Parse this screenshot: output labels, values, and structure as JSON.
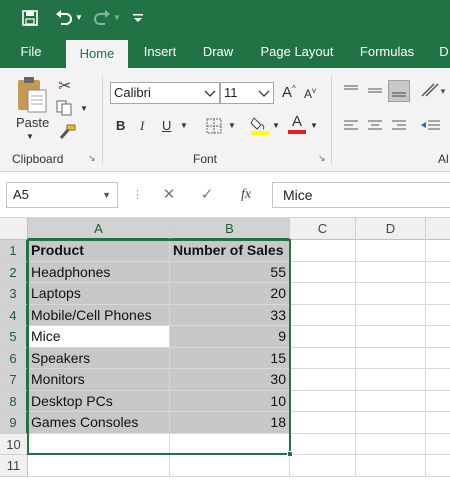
{
  "quick_access": {
    "save_icon": "save-icon",
    "undo_icon": "undo-icon",
    "redo_icon": "redo-icon",
    "customize_icon": "customize-icon"
  },
  "tabs": [
    {
      "label": "File"
    },
    {
      "label": "Home"
    },
    {
      "label": "Insert"
    },
    {
      "label": "Draw"
    },
    {
      "label": "Page Layout"
    },
    {
      "label": "Formulas"
    },
    {
      "label": "D"
    }
  ],
  "ribbon": {
    "clipboard": {
      "paste_label": "Paste",
      "group_label": "Clipboard"
    },
    "font": {
      "font_name": "Calibri",
      "font_size": "11",
      "bold": "B",
      "italic": "I",
      "underline": "U",
      "grow": "A",
      "shrink": "A",
      "font_color_letter": "A",
      "group_label": "Font"
    },
    "alignment": {
      "group_label": "Al"
    }
  },
  "formula_bar": {
    "name_box": "A5",
    "fx": "fx",
    "value": "Mice"
  },
  "columns": [
    "A",
    "B",
    "C",
    "D"
  ],
  "rows": [
    "1",
    "2",
    "3",
    "4",
    "5",
    "6",
    "7",
    "8",
    "9",
    "10",
    "11"
  ],
  "table": {
    "headers": [
      "Product",
      "Number of Sales"
    ],
    "rows": [
      [
        "Headphones",
        "55"
      ],
      [
        "Laptops",
        "20"
      ],
      [
        "Mobile/Cell Phones",
        "33"
      ],
      [
        "Mice",
        "9"
      ],
      [
        "Speakers",
        "15"
      ],
      [
        "Monitors",
        "30"
      ],
      [
        "Desktop PCs",
        "10"
      ],
      [
        "Games Consoles",
        "18"
      ]
    ]
  },
  "colors": {
    "accent": "#217346",
    "selection_fill": "#c8c8c8"
  }
}
